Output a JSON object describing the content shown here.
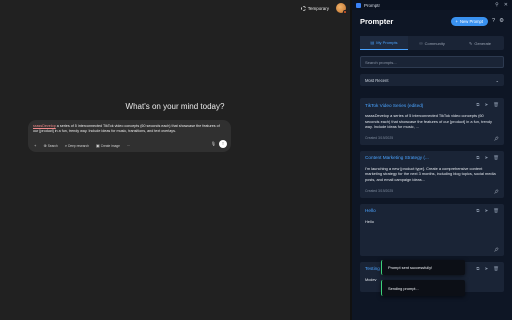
{
  "chat": {
    "temporary_label": "Temporary",
    "headline": "What's on your mind today?",
    "prompt_tag": "sssssDevelop",
    "prompt_text": " a series of 5 interconnected TikTok video concepts (60 seconds each) that showcase the features of our [product] in a fun, trendy way. Include ideas for music, transitions, and text overlays.",
    "tools": {
      "plus": "+",
      "search": "Search",
      "deep_research": "Deep research",
      "create_image": "Create image",
      "more": "···"
    }
  },
  "extension": {
    "window_title": "Promptr",
    "app_title": "Prompter",
    "new_prompt": "New Prompt",
    "tabs": [
      {
        "label": "My Prompts",
        "active": true
      },
      {
        "label": "Community",
        "active": false
      },
      {
        "label": "Generate",
        "active": false
      }
    ],
    "search_placeholder": "Search prompts...",
    "sort_value": "Most Recent",
    "cards": [
      {
        "title": "TikTok Video Series (edited)",
        "body": "sssssDevelop a series of 5 interconnected TikTok video concepts (60 seconds each) that showcase the features of our [product] in a fun, trendy way. Include ideas for music, ...",
        "meta": "Created 3/19/2025"
      },
      {
        "title": "Content Marketing Strategy (...",
        "body": "I'm launching a new [product type]. Create a comprehensive content marketing strategy for the next 3 months, including blog topics, social media posts, and email campaign ideas...",
        "meta": "Created 3/19/2025"
      },
      {
        "title": "Hello",
        "body": "Hello",
        "meta": ""
      },
      {
        "title": "Testing",
        "body": "Mcdev",
        "meta": ""
      }
    ],
    "toasts": {
      "success": "Prompt sent successfully!",
      "sending": "Sending prompt..."
    }
  },
  "colors": {
    "accent": "#4aa3ff",
    "button": "#3a92f0",
    "toast_border": "#3cd27a"
  }
}
